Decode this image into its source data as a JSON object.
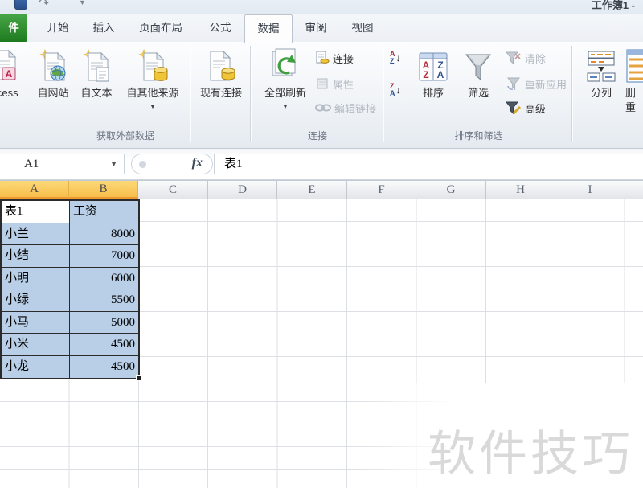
{
  "window": {
    "title_fragment": "工作簿1 -"
  },
  "icons": {
    "dropdown": "▼",
    "redo": "↷",
    "refresh": "⟳"
  },
  "tab_bar": {
    "file_tab": "件",
    "tabs": [
      "开始",
      "插入",
      "页面布局",
      "公式",
      "数据",
      "审阅",
      "视图"
    ],
    "selected_tab": "数据"
  },
  "ribbon": {
    "get_external": {
      "label": "获取外部数据",
      "access": "ccess",
      "from_web": "自网站",
      "from_text": "自文本",
      "from_other": "自其他来源",
      "existing_connections": "现有连接"
    },
    "connections": {
      "label": "连接",
      "refresh_all": "全部刷新",
      "connections_btn": "连接",
      "properties": "属性",
      "edit_links": "编辑链接"
    },
    "sort_filter": {
      "label": "排序和筛选",
      "sort": "排序",
      "filter": "筛选",
      "clear": "清除",
      "reapply": "重新应用",
      "advanced": "高级"
    },
    "data_tools": {
      "text_to_columns": "分列",
      "clipped_label_line1": "删",
      "clipped_label_line2": "重"
    }
  },
  "formula_bar": {
    "name_box": "A1",
    "fx_label": "fx",
    "value": "表1"
  },
  "sheet": {
    "columns": [
      "A",
      "B",
      "C",
      "D",
      "E",
      "F",
      "G",
      "H",
      "I"
    ],
    "selected_columns": "A:B",
    "active_cell": "A1",
    "rows": [
      {
        "a": "表1",
        "b": "工资"
      },
      {
        "a": "小兰",
        "b": "8000"
      },
      {
        "a": "小结",
        "b": "7000"
      },
      {
        "a": "小明",
        "b": "6000"
      },
      {
        "a": "小绿",
        "b": "5500"
      },
      {
        "a": "小马",
        "b": "5000"
      },
      {
        "a": "小米",
        "b": "4500"
      },
      {
        "a": "小龙",
        "b": "4500"
      }
    ]
  },
  "watermark": "软件技巧",
  "colors": {
    "selection_fill": "#b9cfe8",
    "selected_header": "#f9c752",
    "file_tab_green": "#2e8b2e",
    "watermark_gray": "#d9d9d9",
    "grid_line": "#dcdfe3"
  }
}
